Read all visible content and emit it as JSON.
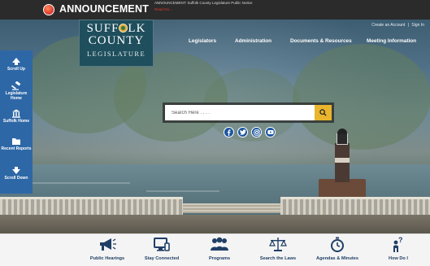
{
  "announcement": {
    "title": "ANNOUNCEMENT",
    "text": "ANNOUNCEMENT: Suffolk County Legislature Public Notice",
    "read_more": "Read On..."
  },
  "account": {
    "create": "Create an Account",
    "separator": "|",
    "sign_in": "Sign In"
  },
  "logo": {
    "line1_a": "SUFF",
    "line1_b": "LK",
    "line2": "COUNTY",
    "line3": "LEGISLATURE"
  },
  "nav": {
    "items": [
      "Legislators",
      "Administration",
      "Documents & Resources",
      "Meeting Information"
    ]
  },
  "rail": {
    "items": [
      {
        "label": "Scroll Up",
        "icon": "arrow-up-icon"
      },
      {
        "label": "Legislature Home",
        "icon": "gavel-icon"
      },
      {
        "label": "Suffolk Home",
        "icon": "building-icon"
      },
      {
        "label": "Recent Reports",
        "icon": "folder-icon"
      },
      {
        "label": "Scroll Down",
        "icon": "arrow-down-icon"
      }
    ]
  },
  "search": {
    "placeholder": "Search Here . . . ."
  },
  "social": [
    "facebook-icon",
    "twitter-icon",
    "instagram-icon",
    "youtube-icon"
  ],
  "quick_links": [
    {
      "label": "Public Hearings",
      "icon": "megaphone-icon"
    },
    {
      "label": "Stay Connected",
      "icon": "monitor-icon"
    },
    {
      "label": "Programs",
      "icon": "people-icon"
    },
    {
      "label": "Search the Laws",
      "icon": "scales-icon"
    },
    {
      "label": "Agendas & Minutes",
      "icon": "stopwatch-icon"
    },
    {
      "label": "How Do I",
      "icon": "question-person-icon"
    }
  ],
  "colors": {
    "rail_blue": "#2e67a6",
    "search_button": "#e9b52d",
    "logo_teal": "#1f4e5c",
    "social_blue": "#1d56a0",
    "quick_label": "#1f3f66"
  }
}
